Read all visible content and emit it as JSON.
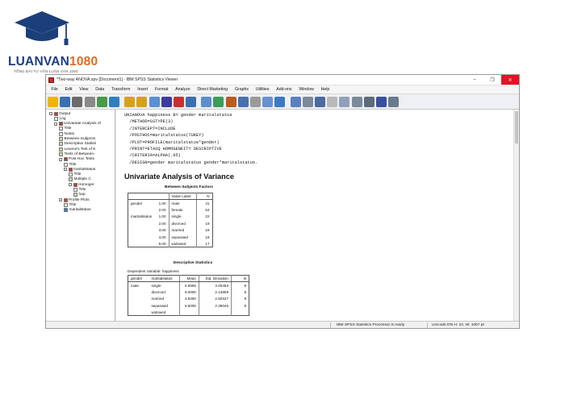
{
  "logo": {
    "brand_primary": "LUANVAN",
    "brand_accent": "1080",
    "tagline": "TỔNG ĐÀI TƯ VẤN LUẬN VĂN 1080",
    "colors": {
      "navy": "#1b3f7a",
      "orange": "#e86a1c"
    }
  },
  "window": {
    "title": "*Two-way ANOVA.spv [Document1] - IBM SPSS Statistics Viewer",
    "controls": {
      "minimize": "–",
      "maximize": "❐",
      "close": "✕"
    }
  },
  "menu": [
    "File",
    "Edit",
    "View",
    "Data",
    "Transform",
    "Insert",
    "Format",
    "Analyze",
    "Direct Marketing",
    "Graphs",
    "Utilities",
    "Add-ons",
    "Window",
    "Help"
  ],
  "toolbar_icons": [
    "open-icon",
    "save-icon",
    "print-icon",
    "print-preview-icon",
    "export-icon",
    "recall-dialog-icon",
    "undo-icon",
    "redo-icon",
    "goto-data-icon",
    "goto-case-icon",
    "goto-variable-icon",
    "variables-icon",
    "designate-window-icon",
    "select-last-output-icon",
    "insert-heading-icon",
    "insert-title-icon",
    "insert-text-icon",
    "show-data-icon",
    "hide-data-icon",
    "promote-icon",
    "demote-icon",
    "expand-icon",
    "collapse-icon",
    "show-icon",
    "hide-icon",
    "split-file-icon",
    "pivot-icon",
    "spell-icon"
  ],
  "nav_tree": [
    {
      "label": "Output",
      "icon": "book",
      "level": 0,
      "toggle": "-"
    },
    {
      "label": "Log",
      "icon": "page",
      "level": 1
    },
    {
      "label": "Univariate Analysis of",
      "icon": "book",
      "level": 1,
      "toggle": "-"
    },
    {
      "label": "Title",
      "icon": "page",
      "level": 2
    },
    {
      "label": "Notes",
      "icon": "page",
      "level": 2
    },
    {
      "label": "Between-Subjects",
      "icon": "table",
      "level": 2
    },
    {
      "label": "Descriptive Statisti",
      "icon": "table",
      "level": 2
    },
    {
      "label": "Levene's Test of E",
      "icon": "table",
      "level": 2
    },
    {
      "label": "Tests of Between-",
      "icon": "table",
      "level": 2
    },
    {
      "label": "Post Hoc Tests",
      "icon": "book",
      "level": 2,
      "toggle": "-"
    },
    {
      "label": "Title",
      "icon": "page",
      "level": 3
    },
    {
      "label": "maritalstatus",
      "icon": "book",
      "level": 3,
      "toggle": "-"
    },
    {
      "label": "Title",
      "icon": "page",
      "level": 4
    },
    {
      "label": "Multiple C",
      "icon": "table",
      "level": 4
    },
    {
      "label": "Homoger",
      "icon": "book",
      "level": 4,
      "toggle": "-"
    },
    {
      "label": "Title",
      "icon": "page",
      "level": 5
    },
    {
      "label": "hap",
      "icon": "table",
      "level": 5
    },
    {
      "label": "Profile Plots",
      "icon": "book",
      "level": 2,
      "toggle": "-"
    },
    {
      "label": "Title",
      "icon": "page",
      "level": 3
    },
    {
      "label": "maritalstatus",
      "icon": "chart",
      "level": 3
    }
  ],
  "syntax": "UNIANOVA happiness BY gender maritalstatus\n  /METHOD=SSTYPE(3)\n  /INTERCEPT=INCLUDE\n  /POSTHOC=maritalstatus(TUKEY)\n  /PLOT=PROFILE(maritalstatus*gender)\n  /PRINT=ETASQ HOMOGENEITY DESCRIPTIVE\n  /CRITERIA=ALPHA(.05)\n  /DESIGN=gender maritalstatus gender*maritalstatus.",
  "section_title": "Univariate Analysis of Variance",
  "between_subjects": {
    "title": "Between-Subjects Factors",
    "headers": [
      "",
      "",
      "Value Label",
      "N"
    ],
    "rows": [
      [
        "gender",
        "1.00",
        "male",
        "41"
      ],
      [
        "",
        "2.00",
        "female",
        "53"
      ],
      [
        "maritalstatus",
        "1.00",
        "single",
        "22"
      ],
      [
        "",
        "2.00",
        "divorced",
        "19"
      ],
      [
        "",
        "3.00",
        "married",
        "18"
      ],
      [
        "",
        "4.00",
        "separated",
        "19"
      ],
      [
        "",
        "5.00",
        "widowed",
        "17"
      ]
    ]
  },
  "descriptive": {
    "title": "Descriptive Statistics",
    "dependent": "Dependent Variable:   happiness",
    "headers": [
      "gender",
      "maritalstatus",
      "Mean",
      "Std. Deviation",
      "N"
    ],
    "rows": [
      [
        "male",
        "single",
        "5.5556",
        "3.00463",
        "9"
      ],
      [
        "",
        "divorced",
        "6.0000",
        "2.13809",
        "8"
      ],
      [
        "",
        "married",
        "4.6250",
        "2.82527",
        "8"
      ],
      [
        "",
        "separated",
        "5.5000",
        "2.39046",
        "8"
      ],
      [
        "",
        "widowed",
        "",
        "",
        ""
      ]
    ]
  },
  "status": {
    "processor": "IBM SPSS Statistics Processor is ready",
    "unicode": "Unicode:ON  H: 22, W: 1067 pt"
  }
}
